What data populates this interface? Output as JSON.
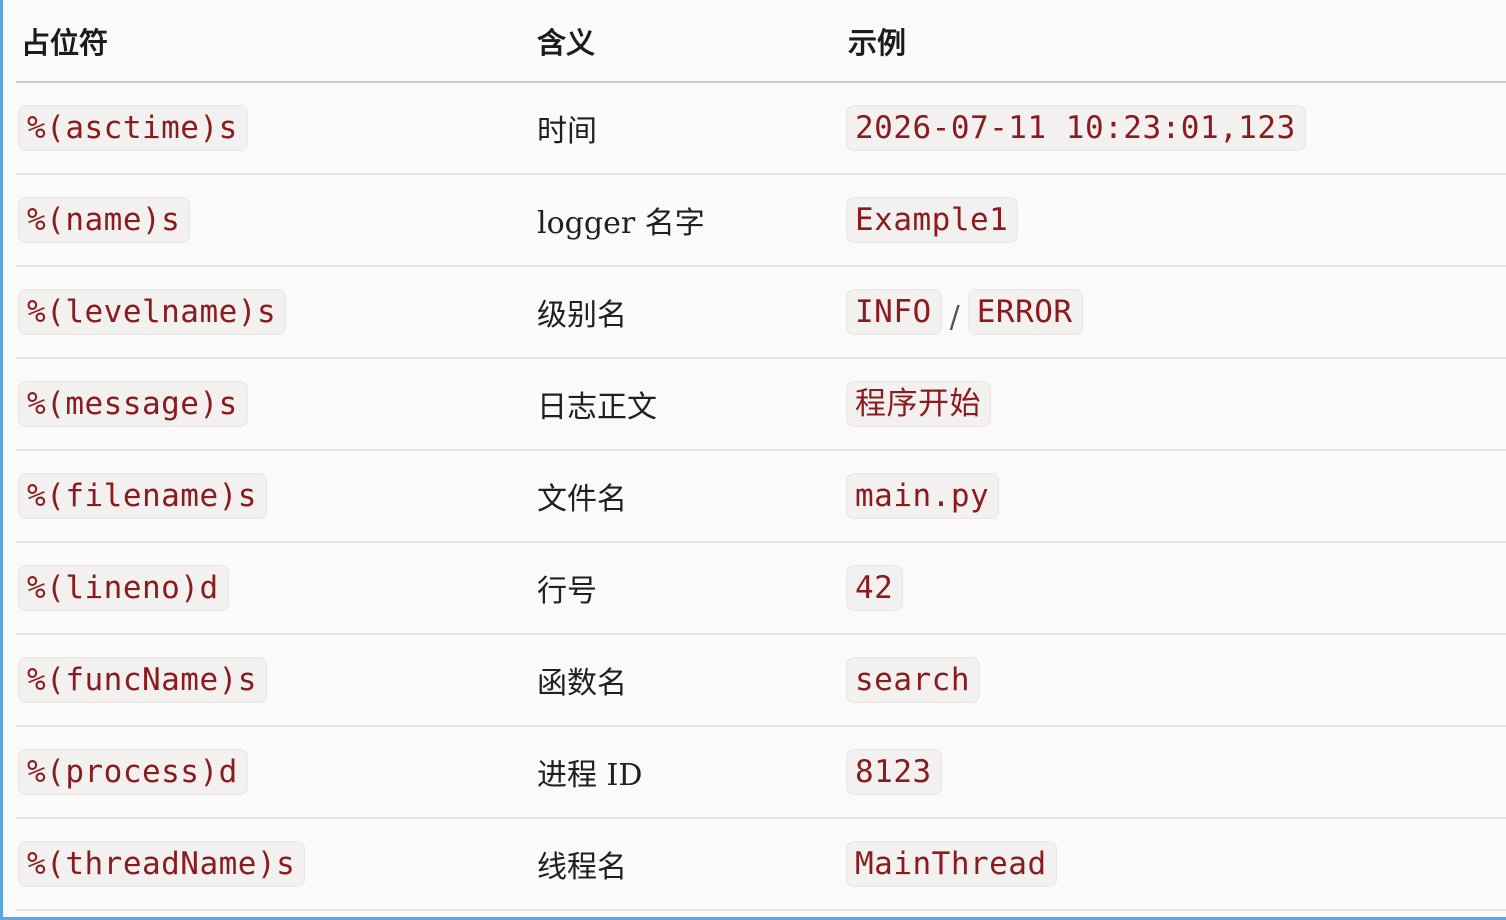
{
  "headers": {
    "placeholder": "占位符",
    "meaning": "含义",
    "example": "示例"
  },
  "rows": [
    {
      "placeholder": "%(asctime)s",
      "meaning": "时间",
      "examples": [
        "2026-07-11 10:23:01,123"
      ]
    },
    {
      "placeholder": "%(name)s",
      "meaning": "logger 名字",
      "examples": [
        "Example1"
      ]
    },
    {
      "placeholder": "%(levelname)s",
      "meaning": "级别名",
      "examples": [
        "INFO",
        "ERROR"
      ],
      "separator": "/"
    },
    {
      "placeholder": "%(message)s",
      "meaning": "日志正文",
      "examples": [
        "程序开始"
      ]
    },
    {
      "placeholder": "%(filename)s",
      "meaning": "文件名",
      "examples": [
        "main.py"
      ]
    },
    {
      "placeholder": "%(lineno)d",
      "meaning": "行号",
      "examples": [
        "42"
      ]
    },
    {
      "placeholder": "%(funcName)s",
      "meaning": "函数名",
      "examples": [
        "search"
      ]
    },
    {
      "placeholder": "%(process)d",
      "meaning": "进程 ID",
      "examples": [
        "8123"
      ]
    },
    {
      "placeholder": "%(threadName)s",
      "meaning": "线程名",
      "examples": [
        "MainThread"
      ]
    }
  ],
  "colors": {
    "code_text": "#8a1c20",
    "code_background": "#f3f0f0",
    "frame_border": "#5aa6e8"
  }
}
